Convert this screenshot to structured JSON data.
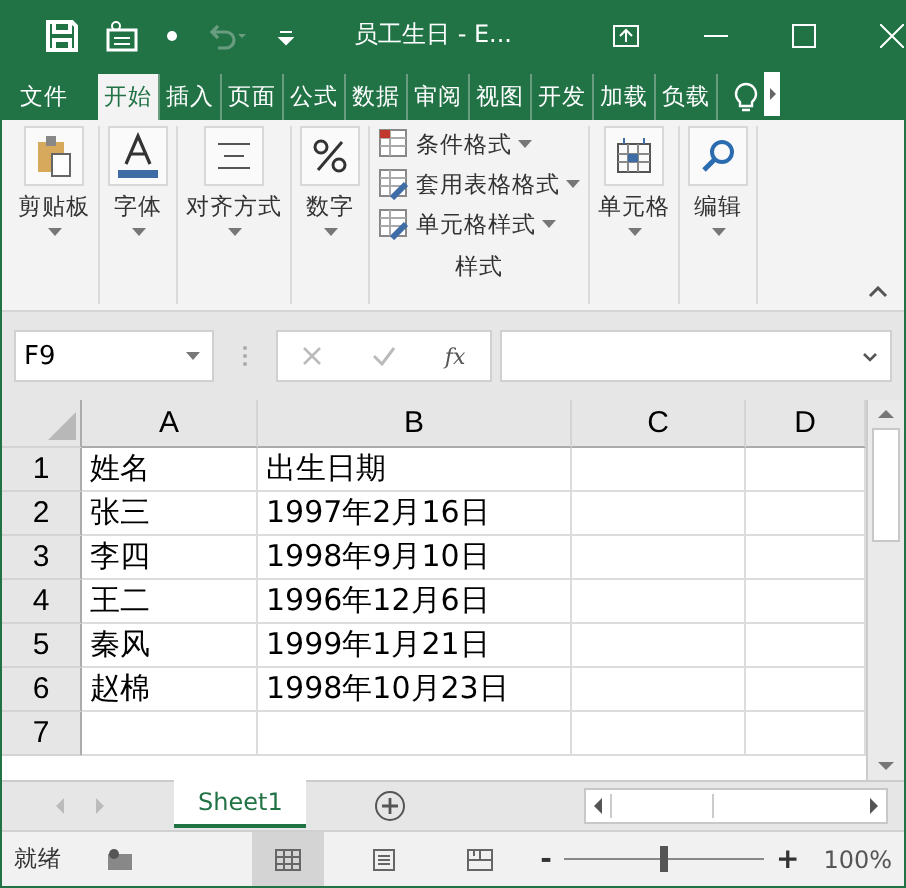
{
  "window": {
    "title": "员工生日 - E..."
  },
  "tabs": [
    {
      "label": "文件",
      "selected": false
    },
    {
      "label": "开始",
      "selected": true
    },
    {
      "label": "插入",
      "selected": false
    },
    {
      "label": "页面",
      "selected": false
    },
    {
      "label": "公式",
      "selected": false
    },
    {
      "label": "数据",
      "selected": false
    },
    {
      "label": "审阅",
      "selected": false
    },
    {
      "label": "视图",
      "selected": false
    },
    {
      "label": "开发",
      "selected": false
    },
    {
      "label": "加载",
      "selected": false
    },
    {
      "label": "负载",
      "selected": false
    }
  ],
  "ribbon": [
    {
      "kind": "big",
      "label": "剪贴板"
    },
    {
      "kind": "big",
      "label": "字体"
    },
    {
      "kind": "big",
      "label": "对齐方式"
    },
    {
      "kind": "big",
      "label": "数字"
    },
    {
      "kind": "stack",
      "label": "样式",
      "items": [
        "条件格式",
        "套用表格格式",
        "单元格样式"
      ]
    },
    {
      "kind": "big",
      "label": "单元格"
    },
    {
      "kind": "big",
      "label": "编辑"
    }
  ],
  "formula_bar": {
    "name_box": "F9",
    "fx": "fx"
  },
  "sheet": {
    "columns": [
      "A",
      "B",
      "C",
      "D"
    ],
    "rows": [
      {
        "num": "1",
        "cells": [
          "姓名",
          "出生日期"
        ]
      },
      {
        "num": "2",
        "cells": [
          "张三",
          "1997年2月16日"
        ]
      },
      {
        "num": "3",
        "cells": [
          "李四",
          "1998年9月10日"
        ]
      },
      {
        "num": "4",
        "cells": [
          "王二",
          "1996年12月6日"
        ]
      },
      {
        "num": "5",
        "cells": [
          "秦风",
          "1999年1月21日"
        ]
      },
      {
        "num": "6",
        "cells": [
          "赵棉",
          "1998年10月23日"
        ]
      },
      {
        "num": "7",
        "cells": []
      }
    ]
  },
  "sheet_tabs": [
    {
      "label": "Sheet1",
      "selected": true
    }
  ],
  "status_bar": {
    "status": "就绪",
    "views": [
      {
        "kind": "normal",
        "selected": true
      },
      {
        "kind": "layout",
        "selected": false
      },
      {
        "kind": "pagebreak",
        "selected": false
      }
    ],
    "zoom": {
      "minus": "-",
      "plus": "+",
      "level": 0.5,
      "reading": "100%"
    }
  }
}
